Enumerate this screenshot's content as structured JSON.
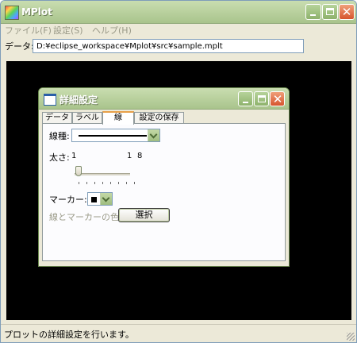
{
  "window": {
    "title": "MPlot"
  },
  "menu": [
    "ファイル(F)",
    "設定(S)",
    "ヘルプ(H)"
  ],
  "data_row": {
    "label": "データ:",
    "path": "D:¥eclipse_workspace¥Mplot¥src¥sample.mplt"
  },
  "status": "プロットの詳細設定を行います。",
  "dialog": {
    "title": "詳細設定",
    "tabs": [
      "データ",
      "ラベル",
      "線",
      "設定の保存"
    ],
    "active_tab": "線",
    "line_type": {
      "label": "線種:"
    },
    "width": {
      "label": "太さ:",
      "min": "1",
      "value": "1",
      "max": "8",
      "level": 0
    },
    "marker": {
      "label": "マーカー:"
    },
    "color": {
      "label": "線とマーカーの色:",
      "button": "選択"
    }
  }
}
